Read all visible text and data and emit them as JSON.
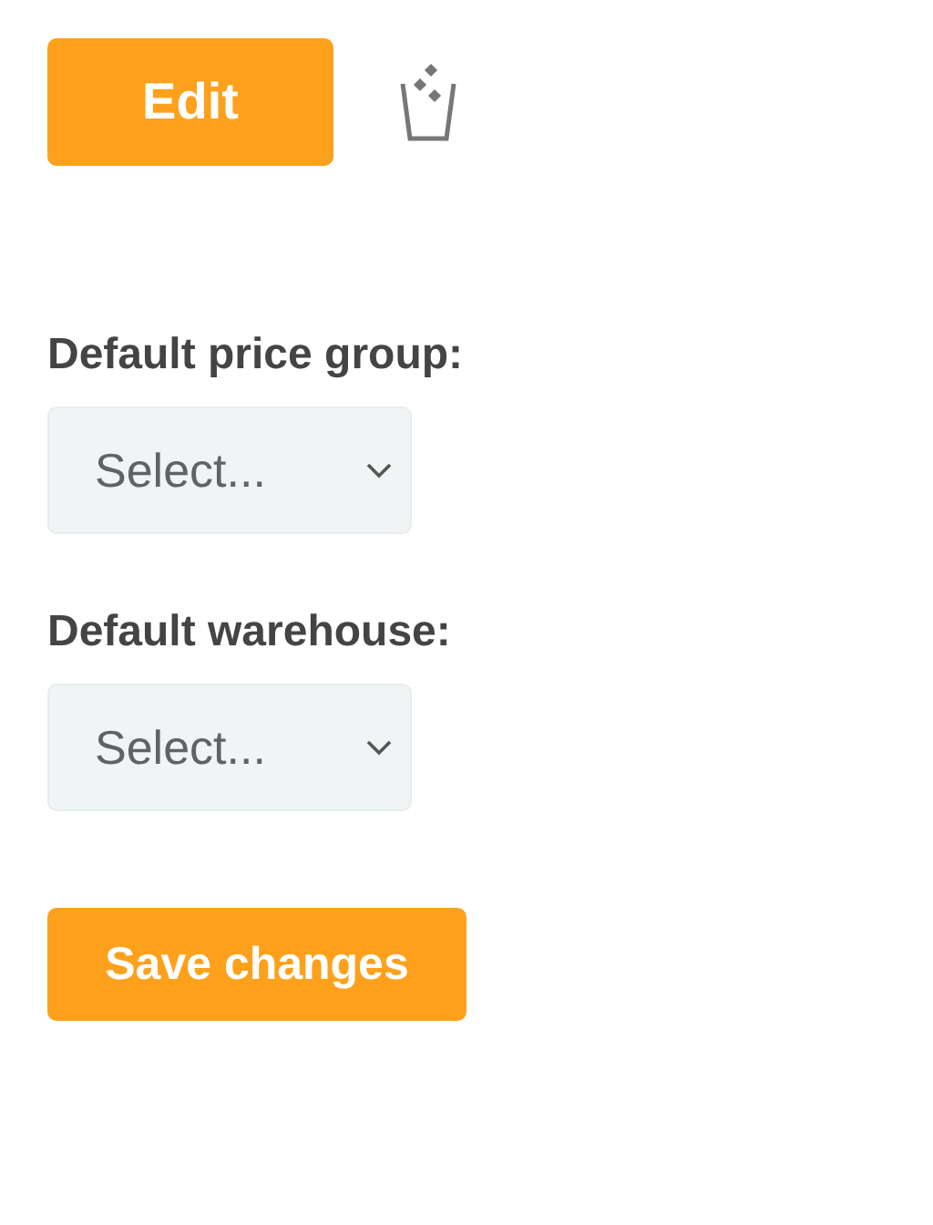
{
  "edit_button": {
    "label": "Edit"
  },
  "fields": [
    {
      "label": "Default price group:",
      "placeholder": "Select..."
    },
    {
      "label": "Default warehouse:",
      "placeholder": "Select..."
    }
  ],
  "save_button": {
    "label": "Save changes"
  }
}
